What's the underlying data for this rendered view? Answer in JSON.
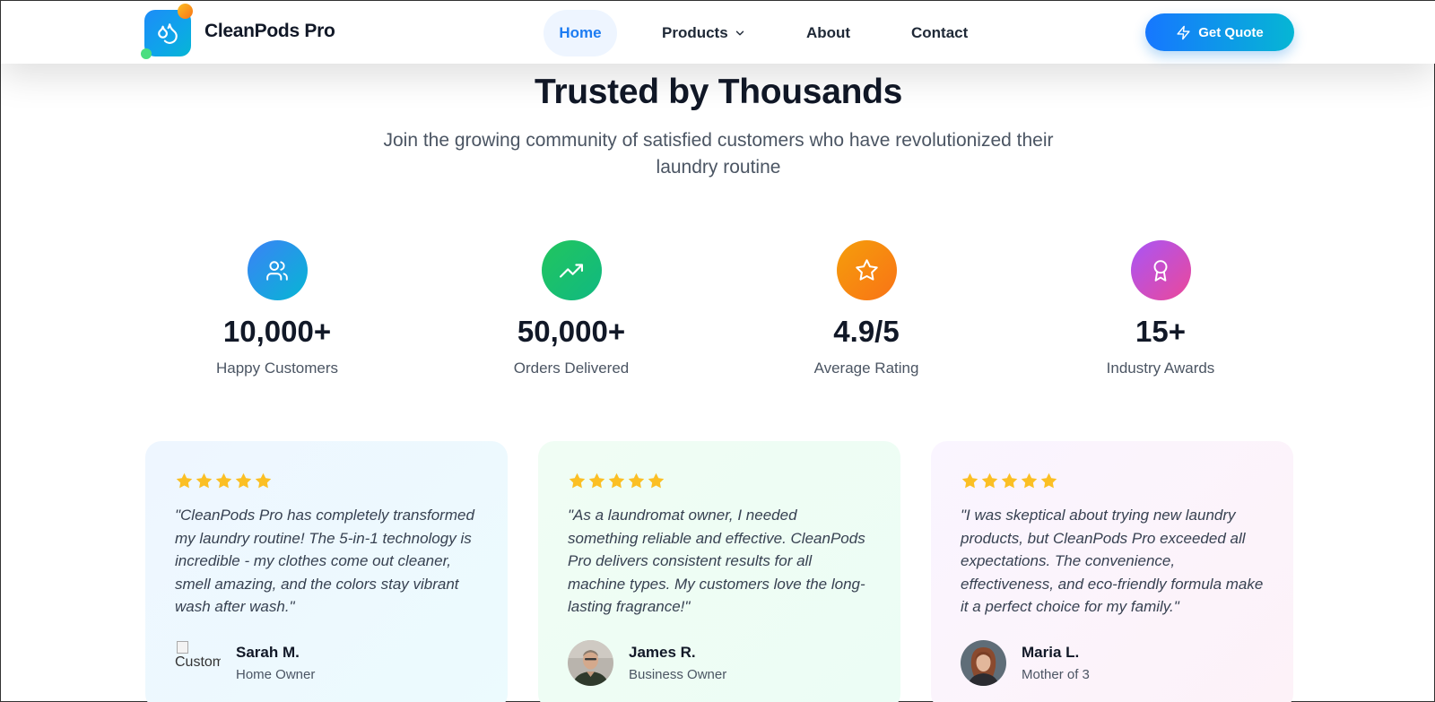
{
  "header": {
    "brand": "CleanPods Pro",
    "nav": {
      "home": "Home",
      "products": "Products",
      "about": "About",
      "contact": "Contact"
    },
    "cta": "Get Quote"
  },
  "section": {
    "title": "Trusted by Thousands",
    "subtitle": "Join the growing community of satisfied customers who have revolutionized their laundry routine"
  },
  "stats": [
    {
      "value": "10,000+",
      "label": "Happy Customers",
      "icon": "users-icon",
      "color": "#3b82f6"
    },
    {
      "value": "50,000+",
      "label": "Orders Delivered",
      "icon": "trending-up-icon",
      "color": "#22c55e"
    },
    {
      "value": "4.9/5",
      "label": "Average Rating",
      "icon": "star-icon",
      "color": "#f59e0b"
    },
    {
      "value": "15+",
      "label": "Industry Awards",
      "icon": "award-icon",
      "color": "#a855f7"
    }
  ],
  "testimonials": [
    {
      "rating": 5,
      "quote": "\"CleanPods Pro has completely transformed my laundry routine! The 5-in-1 technology is incredible - my clothes come out cleaner, smell amazing, and the colors stay vibrant wash after wash.\"",
      "name": "Sarah M.",
      "role": "Home Owner",
      "avatar_alt": "Customer"
    },
    {
      "rating": 5,
      "quote": "\"As a laundromat owner, I needed something reliable and effective. CleanPods Pro delivers consistent results for all machine types. My customers love the long-lasting fragrance!\"",
      "name": "James R.",
      "role": "Business Owner"
    },
    {
      "rating": 5,
      "quote": "\"I was skeptical about trying new laundry products, but CleanPods Pro exceeded all expectations. The convenience, effectiveness, and eco-friendly formula make it a perfect choice for my family.\"",
      "name": "Maria L.",
      "role": "Mother of 3"
    }
  ],
  "colors": {
    "accent": "#1d7cf2",
    "star": "#fbbf24"
  }
}
